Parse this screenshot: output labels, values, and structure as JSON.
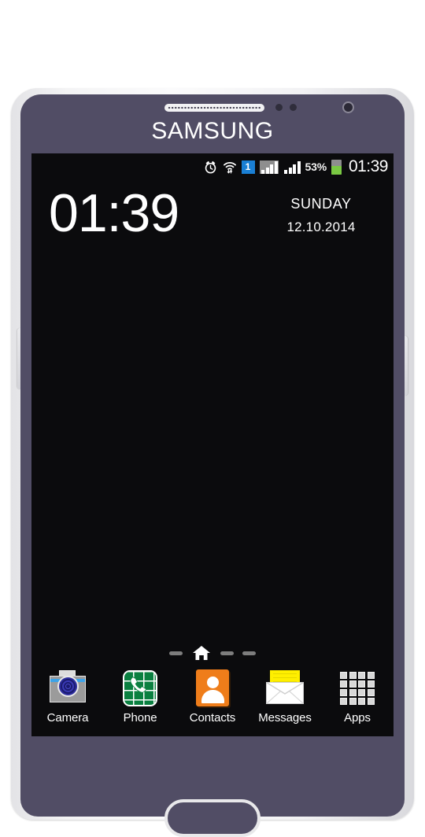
{
  "device": {
    "brand_logo": "SAMSUNG",
    "hardware": {
      "earpiece_speaker": "earpiece-speaker",
      "proximity_sensor": "proximity-sensor",
      "light_sensor": "light-sensor",
      "front_camera": "front-camera",
      "volume_button": "volume-button",
      "power_button": "power-button",
      "home_button": "home-button"
    },
    "body_color": "#514d65",
    "bezel_color": "#f2f2f4"
  },
  "status_bar": {
    "alarm_icon": "alarm-clock-icon",
    "wifi_icon": "wifi-icon",
    "sim_badge": "1",
    "signal_sim1_icon": "signal-bars-icon",
    "signal_sim2_icon": "signal-bars-icon",
    "battery_percent": "53%",
    "battery_level": 53,
    "battery_icon": "battery-icon",
    "battery_color": "#7ac943",
    "clock": "01:39"
  },
  "clock_widget": {
    "time": "01:39",
    "weekday": "SUNDAY",
    "date": "12.10.2014"
  },
  "page_indicator": {
    "pages": 4,
    "current_page": 2,
    "home_icon": "home-icon"
  },
  "dock": {
    "apps": [
      {
        "label": "Camera",
        "icon": "camera-icon",
        "accent": "#3da3e8"
      },
      {
        "label": "Phone",
        "icon": "phone-icon",
        "accent": "#0a8040"
      },
      {
        "label": "Contacts",
        "icon": "contacts-icon",
        "accent": "#ef7d1a"
      },
      {
        "label": "Messages",
        "icon": "messages-icon",
        "accent": "#ffef00"
      },
      {
        "label": "Apps",
        "icon": "apps-grid-icon",
        "accent": "#d8d8d8"
      }
    ]
  }
}
